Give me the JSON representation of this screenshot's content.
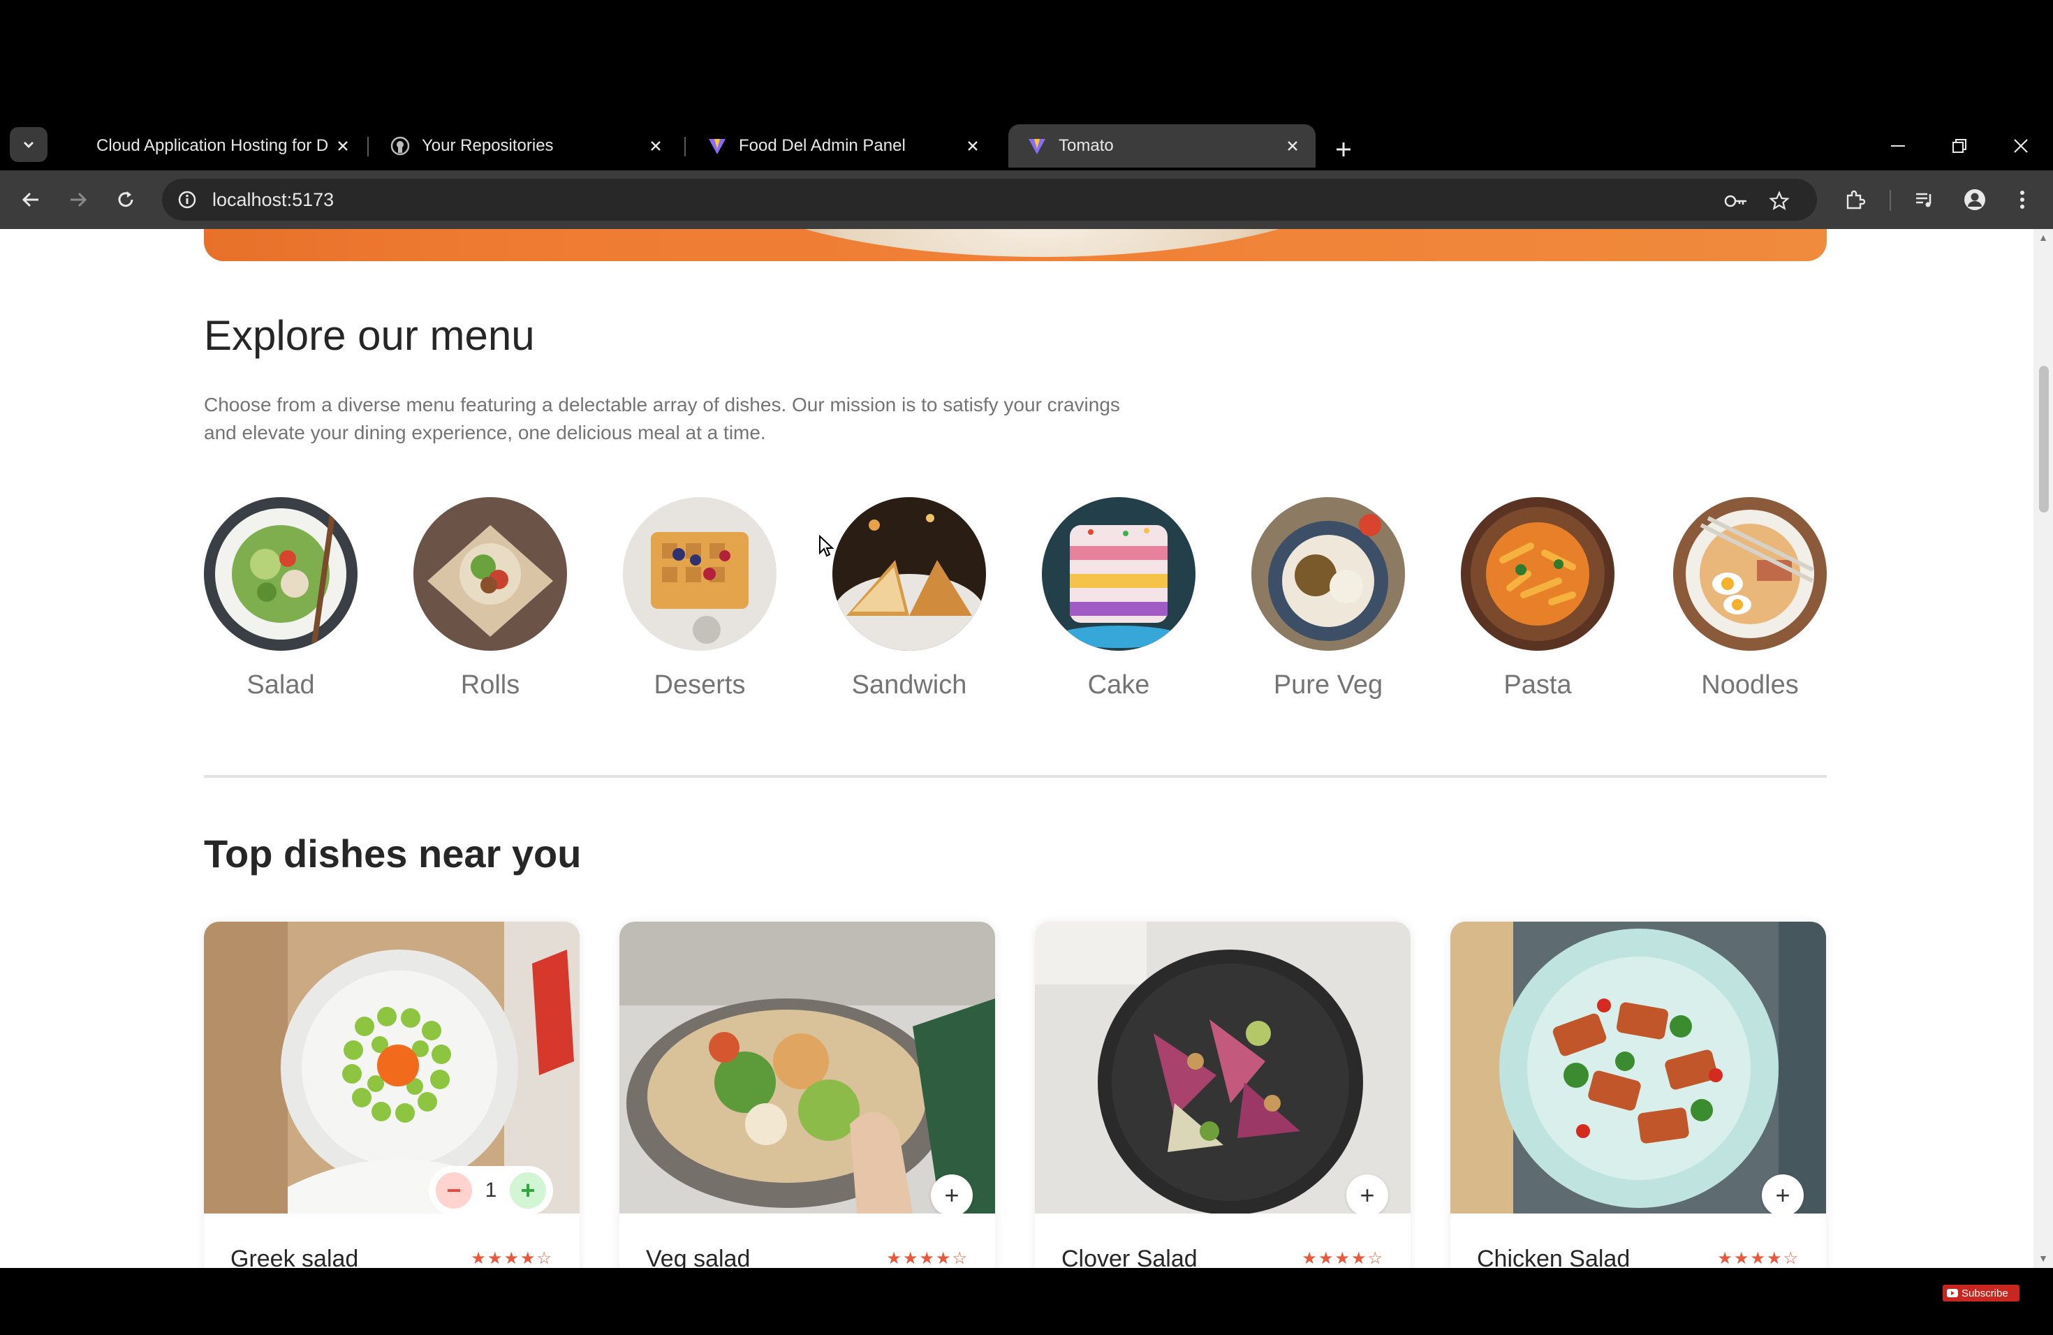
{
  "browser": {
    "tabs": [
      {
        "title": "Cloud Application Hosting for D",
        "favicon": "render-icon",
        "active": false
      },
      {
        "title": "Your Repositories",
        "favicon": "github-icon",
        "active": false
      },
      {
        "title": "Food Del Admin Panel",
        "favicon": "vite-icon",
        "active": false
      },
      {
        "title": "Tomato",
        "favicon": "vite-icon",
        "active": true
      }
    ],
    "url": "localhost:5173"
  },
  "page": {
    "menu_title": "Explore our menu",
    "menu_text": "Choose from a diverse menu featuring a delectable array of dishes. Our mission is to satisfy your cravings and elevate your dining experience, one delicious meal at a time.",
    "menu_items": [
      {
        "label": "Salad"
      },
      {
        "label": "Rolls"
      },
      {
        "label": "Deserts"
      },
      {
        "label": "Sandwich"
      },
      {
        "label": "Cake"
      },
      {
        "label": "Pure Veg"
      },
      {
        "label": "Pasta"
      },
      {
        "label": "Noodles"
      }
    ],
    "dishes_title": "Top dishes near you",
    "dishes": [
      {
        "name": "Greek salad",
        "rating": "★★★★☆",
        "in_cart": 1,
        "count": "1"
      },
      {
        "name": "Veg salad",
        "rating": "★★★★☆",
        "in_cart": 0
      },
      {
        "name": "Clover Salad",
        "rating": "★★★★☆",
        "in_cart": 0
      },
      {
        "name": "Chicken Salad",
        "rating": "★★★★☆",
        "in_cart": 0
      }
    ],
    "counter": {
      "minus": "−",
      "plus": "+"
    },
    "add_symbol": "+"
  },
  "overlay": {
    "subscribe": "Subscribe"
  },
  "colors": {
    "brand": "#ff6347",
    "chrome": "#3c3c3c",
    "text_muted": "#747474"
  }
}
